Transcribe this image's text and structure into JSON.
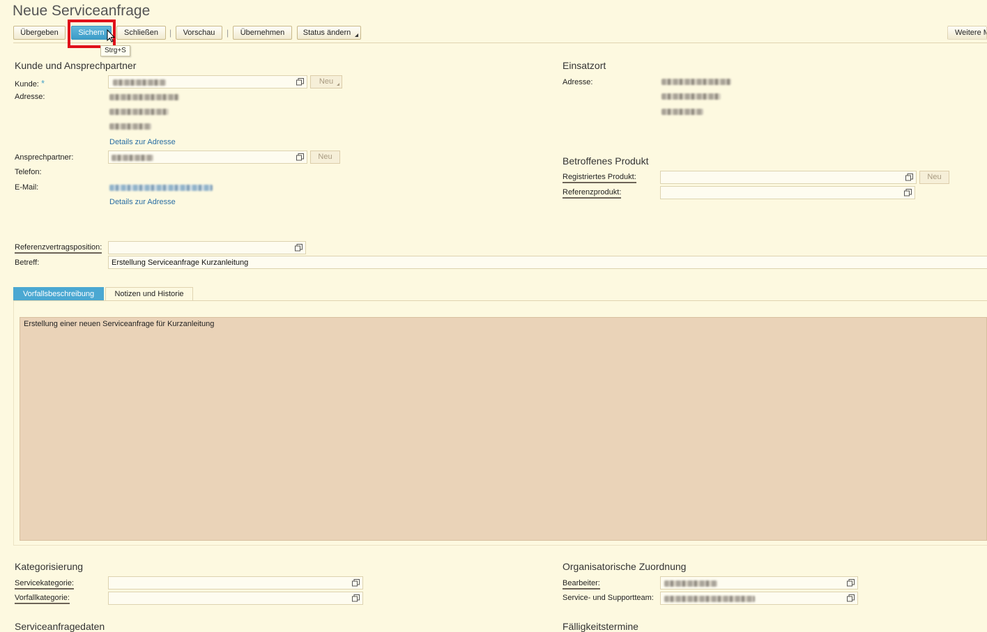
{
  "page_title": "Neue Serviceanfrage",
  "toolbar": {
    "buttons": [
      {
        "label": "Übergeben"
      },
      {
        "label": "Sichern"
      },
      {
        "label": "Schließen"
      },
      {
        "label": "Vorschau"
      },
      {
        "label": "Übernehmen"
      },
      {
        "label": "Status ändern"
      },
      {
        "label": "Weitere M"
      }
    ],
    "separator": "|",
    "tooltip": "Strg+S"
  },
  "customer_section": {
    "title": "Kunde und Ansprechpartner",
    "kunde_label": "Kunde:",
    "required_mark": "*",
    "neu_label": "Neu",
    "adresse_label": "Adresse:",
    "details_link": "Details zur Adresse",
    "ansprechpartner_label": "Ansprechpartner:",
    "telefon_label": "Telefon:",
    "email_label": "E-Mail:",
    "details_link2": "Details zur Adresse"
  },
  "einsatzort": {
    "title": "Einsatzort",
    "adresse_label": "Adresse:"
  },
  "product_section": {
    "title": "Betroffenes Produkt",
    "registered_label": "Registriertes Produkt:",
    "reference_label": "Referenzprodukt:",
    "neu_label": "Neu"
  },
  "contract": {
    "reference_label": "Referenzvertragsposition:",
    "betreff_label": "Betreff:",
    "betreff_value": "Erstellung Serviceanfrage Kurzanleitung"
  },
  "tabs": [
    {
      "label": "Vorfallsbeschreibung",
      "active": true
    },
    {
      "label": "Notizen und Historie",
      "active": false
    }
  ],
  "description": "Erstellung einer neuen Serviceanfrage für Kurzanleitung",
  "categorization": {
    "title": "Kategorisierung",
    "service_label": "Servicekategorie:",
    "incident_label": "Vorfallkategorie:"
  },
  "organisation": {
    "title": "Organisatorische Zuordnung",
    "editor_label": "Bearbeiter:",
    "team_label": "Service- und Supportteam:"
  },
  "service_data": {
    "title": "Serviceanfragedaten"
  },
  "deadlines": {
    "title": "Fälligkeitstermine"
  },
  "colors": {
    "background": "#fdf9e0",
    "accent": "#4ba8d2",
    "highlight": "#e0101a",
    "description_bg": "#ead3b8"
  }
}
